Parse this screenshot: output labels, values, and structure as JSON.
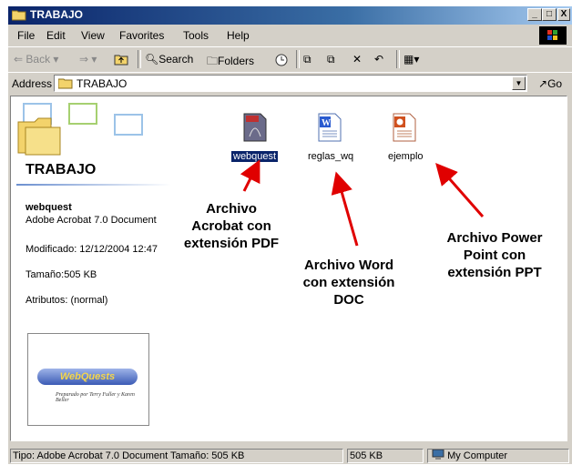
{
  "window": {
    "title": "TRABAJO"
  },
  "title_buttons": {
    "minimize": "_",
    "maximize": "□",
    "close": "X"
  },
  "menu": {
    "file": "File",
    "edit": "Edit",
    "view": "View",
    "favorites": "Favorites",
    "tools": "Tools",
    "help": "Help"
  },
  "toolbar": {
    "back": "Back",
    "search": "Search",
    "folders": "Folders"
  },
  "address": {
    "label": "Address",
    "value": "TRABAJO",
    "go": "Go"
  },
  "panel": {
    "folder_title": "TRABAJO",
    "selected_name": "webquest",
    "selected_type": "Adobe Acrobat 7.0 Document",
    "modified": "Modificado: 12/12/2004 12:47",
    "size": "Tamaño:505 KB",
    "attributes": "Atributos: (normal)",
    "thumb_title": "WebQuests",
    "thumb_caption": "Preparado por Terry Fuller y Karen Beller"
  },
  "files": [
    {
      "name": "webquest",
      "icon": "pdf-file-icon"
    },
    {
      "name": "reglas_wq",
      "icon": "word-doc-icon"
    },
    {
      "name": "ejemplo",
      "icon": "powerpoint-file-icon"
    }
  ],
  "annotations": {
    "pdf": [
      "Archivo",
      "Acrobat con",
      "extensión PDF"
    ],
    "word": [
      "Archivo Word",
      "con extensión",
      "DOC"
    ],
    "ppt": [
      "Archivo Power",
      "Point con",
      "extensión PPT"
    ]
  },
  "status": {
    "info": "Tipo: Adobe Acrobat 7.0 Document Tamaño: 505 KB",
    "size": "505 KB",
    "zone": "My Computer"
  },
  "colors": {
    "titlebar": "#0a246a",
    "selection": "#0a246a",
    "arrows": "#e00000"
  }
}
